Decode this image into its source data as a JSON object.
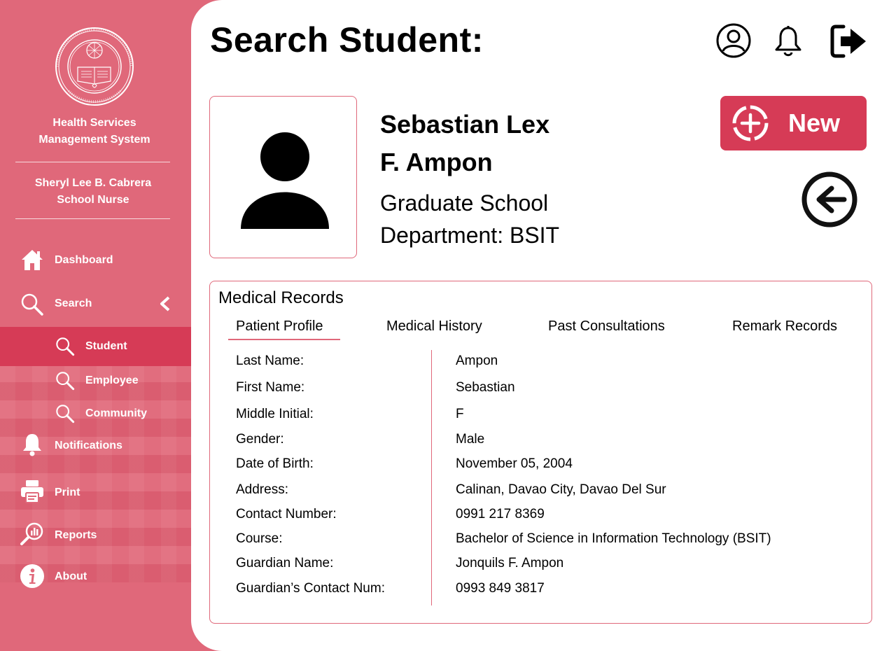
{
  "sidebar": {
    "system_title_line1": "Health Services",
    "system_title_line2": "Management System",
    "user_name": "Sheryl Lee B. Cabrera",
    "user_role": "School Nurse",
    "logo_text": "UNIVERSITY OF THE IMMACULATE CONCEPTION • DAVAO CITY • 1905",
    "items": [
      {
        "label": "Dashboard",
        "icon": "home-icon"
      },
      {
        "label": "Search",
        "icon": "search-icon"
      },
      {
        "label": "Student",
        "icon": "search-icon"
      },
      {
        "label": "Employee",
        "icon": "search-icon"
      },
      {
        "label": "Community",
        "icon": "search-icon"
      },
      {
        "label": "Notifications",
        "icon": "bell-icon"
      },
      {
        "label": "Print",
        "icon": "printer-icon"
      },
      {
        "label": "Reports",
        "icon": "reports-icon"
      },
      {
        "label": "About",
        "icon": "info-icon"
      }
    ],
    "active_item": "Student"
  },
  "header": {
    "title": "Search Student:",
    "icons": [
      "user-icon",
      "bell-icon",
      "logout-icon"
    ]
  },
  "student": {
    "name_line1": "Sebastian Lex",
    "name_line2": "F. Ampon",
    "school": "Graduate School",
    "department": "Department: BSIT"
  },
  "actions": {
    "new_label": "New"
  },
  "records": {
    "title": "Medical Records",
    "tabs": [
      "Patient Profile",
      "Medical History",
      "Past Consultations",
      "Remark Records"
    ],
    "active_tab": "Patient Profile",
    "fields": [
      {
        "label": "Last Name:",
        "value": "Ampon"
      },
      {
        "label": "First Name:",
        "value": "Sebastian"
      },
      {
        "label": "Middle Initial:",
        "value": "F"
      },
      {
        "label": "Gender:",
        "value": "Male"
      },
      {
        "label": "Date of Birth:",
        "value": "November 05, 2004"
      },
      {
        "label": "Address:",
        "value": "Calinan, Davao City, Davao Del Sur"
      },
      {
        "label": "Contact Number:",
        "value": "0991 217 8369"
      },
      {
        "label": "Course:",
        "value": "Bachelor of Science in Information Technology (BSIT)"
      },
      {
        "label": "Guardian Name:",
        "value": "Jonquils F. Ampon"
      },
      {
        "label": "Guardian’s Contact Num:",
        "value": "0993 849 3817"
      }
    ]
  },
  "colors": {
    "sidebar": "#e0687a",
    "accent": "#d63b56",
    "border": "#e0687a"
  }
}
